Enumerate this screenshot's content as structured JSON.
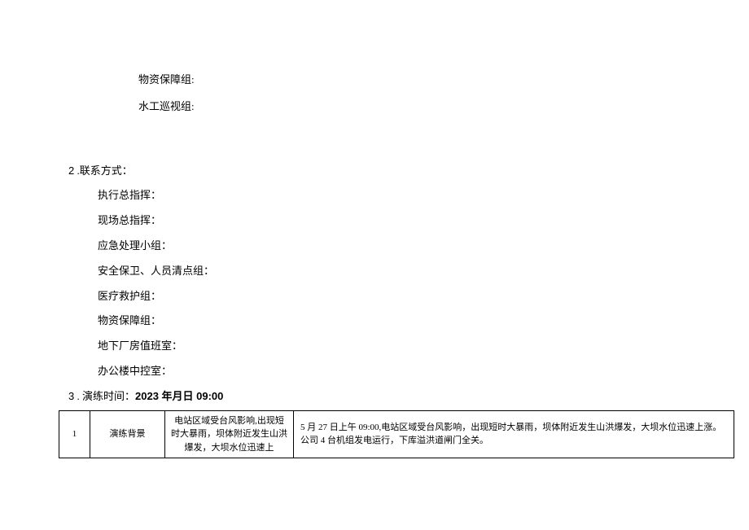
{
  "top_items": {
    "item1": "物资保障组:",
    "item2": "水工巡视组:"
  },
  "section2": {
    "heading_num": "2",
    "heading_text": " .联系方式：",
    "items": {
      "i1": "执行总指挥：",
      "i2": "现场总指挥：",
      "i3": "应急处理小组：",
      "i4": "安全保卫、人员清点组：",
      "i5": "医疗救护组：",
      "i6": "物资保障组：",
      "i7": "地下厂房值班室：",
      "i8": "办公楼中控室："
    }
  },
  "section3": {
    "heading_num": "3",
    "heading_text_plain": " . 演练时间：",
    "heading_text_bold": "2023 年月日 09:00"
  },
  "table": {
    "rows": [
      {
        "c1": "1",
        "c2": "演练背景",
        "c3": "电站区域受台风影响,出现短时大暴雨，坝体附近发生山洪爆发，大坝水位迅速上",
        "c4": "5 月 27 日上午 09:00,电站区域受台风影响，出现短时大暴雨，坝体附近发生山洪爆发，大坝水位迅速上涨。公司 4 台机组发电运行，下库溢洪道闸门全关。"
      }
    ]
  }
}
